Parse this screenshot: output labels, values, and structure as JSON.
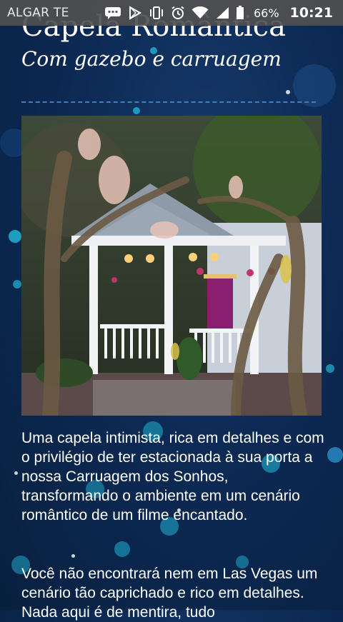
{
  "status_bar": {
    "carrier": "ALGAR TE",
    "battery_percent": "66%",
    "time": "10:21"
  },
  "header": {
    "title": "Capela Romântica",
    "subtitle": "Com gazebo e carruagem"
  },
  "content": {
    "paragraph_1": "Uma capela intimista, rica em detalhes e com o privilégio de ter estacionada à sua porta a nossa Carruagem dos Sonhos, transformando o ambiente em um cenário romântico de um filme encantado.",
    "paragraph_2": "Você não encontrará nem em Las Vegas um cenário tão caprichado e rico em detalhes. Nada aqui é de mentira, tudo"
  },
  "colors": {
    "background": "#0d2a55",
    "divider": "#3f7fc0",
    "bokeh": "#23b8d8"
  }
}
